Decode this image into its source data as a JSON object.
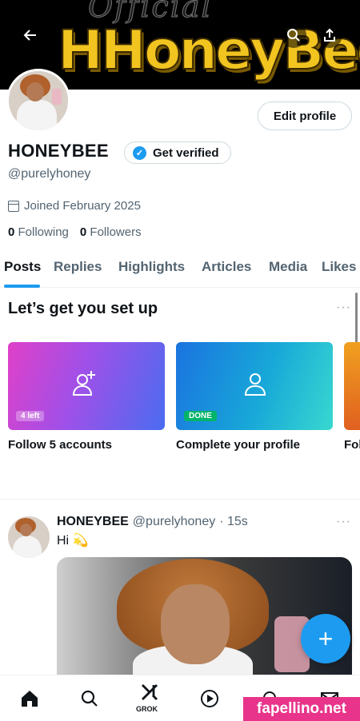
{
  "banner": {
    "script_text": "Official",
    "title_text": "HHoneyBee",
    "back_icon": "arrow-left-icon",
    "search_icon": "search-icon",
    "share_icon": "share-icon"
  },
  "profile": {
    "edit_label": "Edit profile",
    "name": "HONEYBEE",
    "verify_label": "Get verified",
    "handle": "@purelyhoney",
    "joined": "Joined February 2025",
    "following_count": "0",
    "following_label": "Following",
    "followers_count": "0",
    "followers_label": "Followers"
  },
  "tabs": [
    "Posts",
    "Replies",
    "Highlights",
    "Articles",
    "Media",
    "Likes"
  ],
  "active_tab": "Posts",
  "setup": {
    "title": "Let’s get you set up",
    "more": "···",
    "cards": [
      {
        "label": "Follow 5 accounts",
        "pill": "4 left"
      },
      {
        "label": "Complete your profile",
        "pill": "DONE"
      },
      {
        "label": "Fol"
      }
    ]
  },
  "post": {
    "name": "HONEYBEE",
    "handle": "@purelyhoney",
    "time": "· 15s",
    "text": "Hi 💫",
    "more": "···"
  },
  "fab_label": "+",
  "bottom_nav": {
    "grok_label": "GROK"
  },
  "watermark": "fapellino.net",
  "colors": {
    "accent": "#1d9bf0",
    "done_green": "#00b36b",
    "banner_yellow": "#f2c420"
  }
}
